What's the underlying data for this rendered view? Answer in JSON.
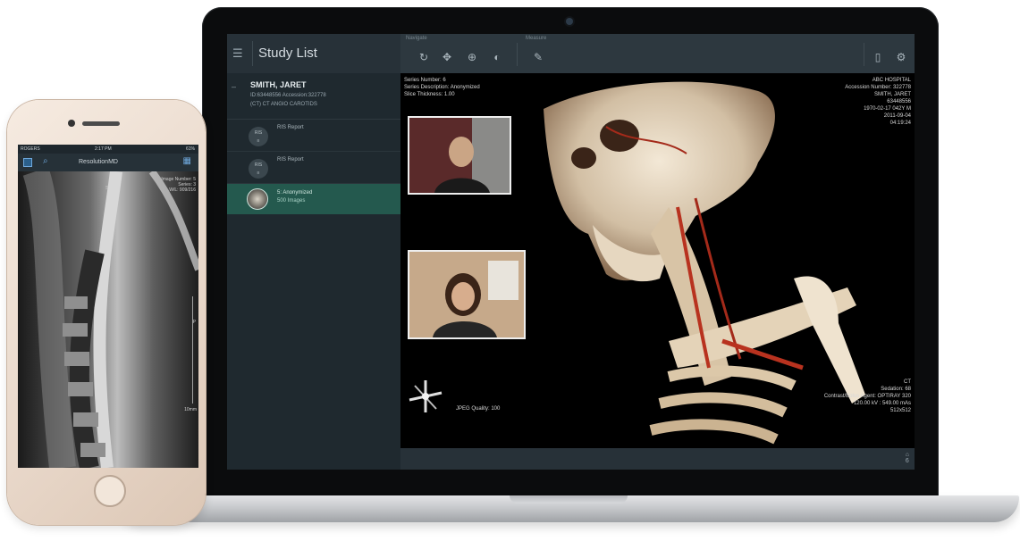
{
  "laptop_app": {
    "study_list_title": "Study List",
    "toolbar": {
      "navigate_label": "Navigate",
      "measure_label": "Measure"
    },
    "patient": {
      "name": "SMITH, JARET",
      "ids": "ID:63448556  Accession:322778",
      "study": "(CT) CT ANGIO CAROTIDS"
    },
    "reports": [
      {
        "badge": "RIS",
        "label": "RIS Report"
      },
      {
        "badge": "RIS",
        "label": "RIS Report"
      }
    ],
    "selected_series": {
      "title": "5: Anonymized",
      "count": "500 Images"
    },
    "overlay_top_left": [
      "Series Number: 6",
      "Series Description: Anonymized",
      "Slice Thickness: 1.00"
    ],
    "overlay_top_right": [
      "ABC HOSPITAL",
      "Accession Number: 322778",
      "SMITH, JARET",
      "63448556",
      "1970-02-17 042Y M",
      "2011-09-04",
      "04:19:24"
    ],
    "overlay_bottom_right": [
      "CT",
      "Sedation: 68",
      "Contrast/Bolus Agent: OPTIRAY 320",
      "120.00 kV : 549.00 mAs",
      "512x512"
    ],
    "jpeg_quality": "JPEG Quality: 100",
    "bottom_icon_label": "6"
  },
  "phone_app": {
    "status": {
      "carrier": "ROGERS",
      "time": "2:17 PM",
      "battery": "61%"
    },
    "title": "ResolutionMD",
    "overlay": [
      "Image Number: 5",
      "Series: 3",
      "W/L: 909/216"
    ],
    "side_marker_s": "S",
    "side_marker_p": "P",
    "scale_label": "10mm"
  },
  "colors": {
    "app_chrome": "#273138",
    "sidebar": "#1f292f",
    "selected_row": "#24594e",
    "phone_body": "#e8d7c9"
  }
}
